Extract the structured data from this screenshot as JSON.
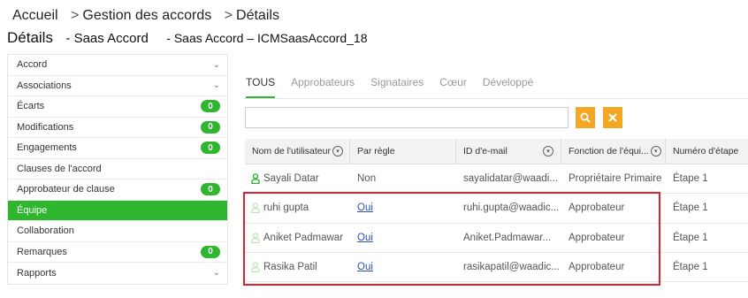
{
  "breadcrumb": {
    "home": "Accueil",
    "section": "Gestion des accords",
    "current": "Détails",
    "separator": ">"
  },
  "title": {
    "label": "Détails",
    "agreement": "- Saas Accord",
    "subtitle": "- Saas Accord – ICMSaasAccord_18"
  },
  "sidebar": {
    "items": [
      {
        "label": "Accord",
        "chevron": "⌄"
      },
      {
        "label": "Associations",
        "chevron": "⌄"
      },
      {
        "label": "Écarts",
        "badge": "0"
      },
      {
        "label": "Modifications",
        "badge": "0"
      },
      {
        "label": "Engagements",
        "badge": "0"
      },
      {
        "label": "Clauses de l'accord"
      },
      {
        "label": "Approbateur de clause",
        "badge": "0"
      },
      {
        "label": "Équipe"
      },
      {
        "label": "Collaboration"
      },
      {
        "label": "Remarques",
        "badge": "0"
      },
      {
        "label": "Rapports",
        "chevron": "⌄"
      }
    ]
  },
  "tabs": [
    "TOUS",
    "Approbateurs",
    "Signataires",
    "Cœur",
    "Développé"
  ],
  "search": {
    "value": "",
    "placeholder": ""
  },
  "table": {
    "headers": [
      "Nom de l'utilisateur",
      "Par règle",
      "ID d'e-mail",
      "Fonction de l'équi...",
      "Numéro d'étape"
    ],
    "rows": [
      {
        "name": "Sayali Datar",
        "rule": "Non",
        "email": "sayalidatar@waadi...",
        "role": "Propriétaire Primaire",
        "step": "Étape 1",
        "icon_color": "#2fb62f"
      },
      {
        "name": "ruhi gupta",
        "rule": "Oui",
        "email": "ruhi.gupta@waadic...",
        "role": "Approbateur",
        "step": "Étape 1",
        "icon_color": "#b9e3b9"
      },
      {
        "name": "Aniket Padmawar",
        "rule": "Oui",
        "email": "Aniket.Padmawar...",
        "role": "Approbateur",
        "step": "Étape 1",
        "icon_color": "#b9e3b9"
      },
      {
        "name": "Rasika Patil",
        "rule": "Oui",
        "email": "rasikapatil@waadic...",
        "role": "Approbateur",
        "step": "Étape 1",
        "icon_color": "#b9e3b9"
      }
    ]
  },
  "colors": {
    "accent": "#2fb62f",
    "button": "#f5a623",
    "highlight": "#e0202a",
    "link": "#2a4fb8"
  }
}
